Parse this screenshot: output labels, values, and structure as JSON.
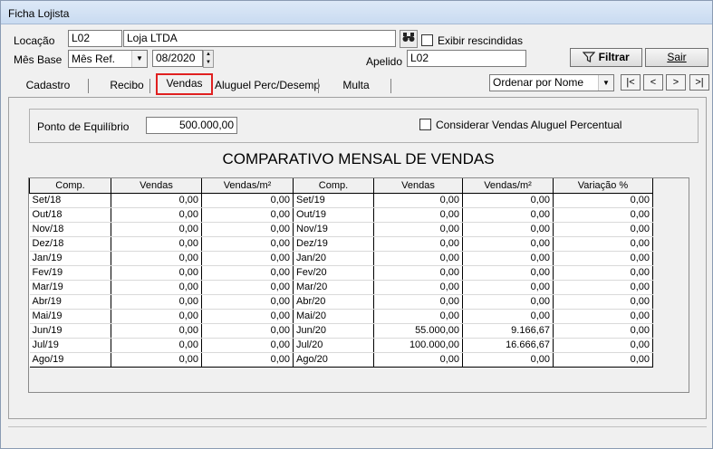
{
  "window": {
    "title": "Ficha Lojista"
  },
  "filters": {
    "locacao_label": "Locação",
    "locacao_code": "L02",
    "locacao_name": "Loja LTDA",
    "exibir_rescindidas_label": "Exibir rescindidas",
    "mes_base_label": "Mês Base",
    "mes_base_select": "Mês Ref.",
    "mes_base_value": "08/2020",
    "apelido_label": "Apelido",
    "apelido_value": "L02",
    "filtrar_label": "Filtrar",
    "sair_label": "Sair"
  },
  "tabs": [
    {
      "label": "Cadastro"
    },
    {
      "label": "Recibo"
    },
    {
      "label": "Vendas",
      "active": true
    },
    {
      "label": "Aluguel Perc/Desemp"
    },
    {
      "label": "Multa"
    }
  ],
  "order_select": "Ordenar por Nome",
  "nav_buttons": [
    "|<",
    "<",
    ">",
    ">|"
  ],
  "vendas": {
    "ponto_equilibrio_label": "Ponto de Equilíbrio",
    "ponto_equilibrio_value": "500.000,00",
    "considerar_label": "Considerar Vendas Aluguel Percentual",
    "heading": "COMPARATIVO MENSAL DE VENDAS",
    "columns": [
      "Comp.",
      "Vendas",
      "Vendas/m²",
      "Comp.",
      "Vendas",
      "Vendas/m²",
      "Variação %"
    ],
    "rows": [
      [
        "Set/18",
        "0,00",
        "0,00",
        "Set/19",
        "0,00",
        "0,00",
        "0,00"
      ],
      [
        "Out/18",
        "0,00",
        "0,00",
        "Out/19",
        "0,00",
        "0,00",
        "0,00"
      ],
      [
        "Nov/18",
        "0,00",
        "0,00",
        "Nov/19",
        "0,00",
        "0,00",
        "0,00"
      ],
      [
        "Dez/18",
        "0,00",
        "0,00",
        "Dez/19",
        "0,00",
        "0,00",
        "0,00"
      ],
      [
        "Jan/19",
        "0,00",
        "0,00",
        "Jan/20",
        "0,00",
        "0,00",
        "0,00"
      ],
      [
        "Fev/19",
        "0,00",
        "0,00",
        "Fev/20",
        "0,00",
        "0,00",
        "0,00"
      ],
      [
        "Mar/19",
        "0,00",
        "0,00",
        "Mar/20",
        "0,00",
        "0,00",
        "0,00"
      ],
      [
        "Abr/19",
        "0,00",
        "0,00",
        "Abr/20",
        "0,00",
        "0,00",
        "0,00"
      ],
      [
        "Mai/19",
        "0,00",
        "0,00",
        "Mai/20",
        "0,00",
        "0,00",
        "0,00"
      ],
      [
        "Jun/19",
        "0,00",
        "0,00",
        "Jun/20",
        "55.000,00",
        "9.166,67",
        "0,00"
      ],
      [
        "Jul/19",
        "0,00",
        "0,00",
        "Jul/20",
        "100.000,00",
        "16.666,67",
        "0,00"
      ],
      [
        "Ago/19",
        "0,00",
        "0,00",
        "Ago/20",
        "0,00",
        "0,00",
        "0,00"
      ]
    ]
  },
  "colors": {
    "active_tab_border": "#e02020"
  }
}
